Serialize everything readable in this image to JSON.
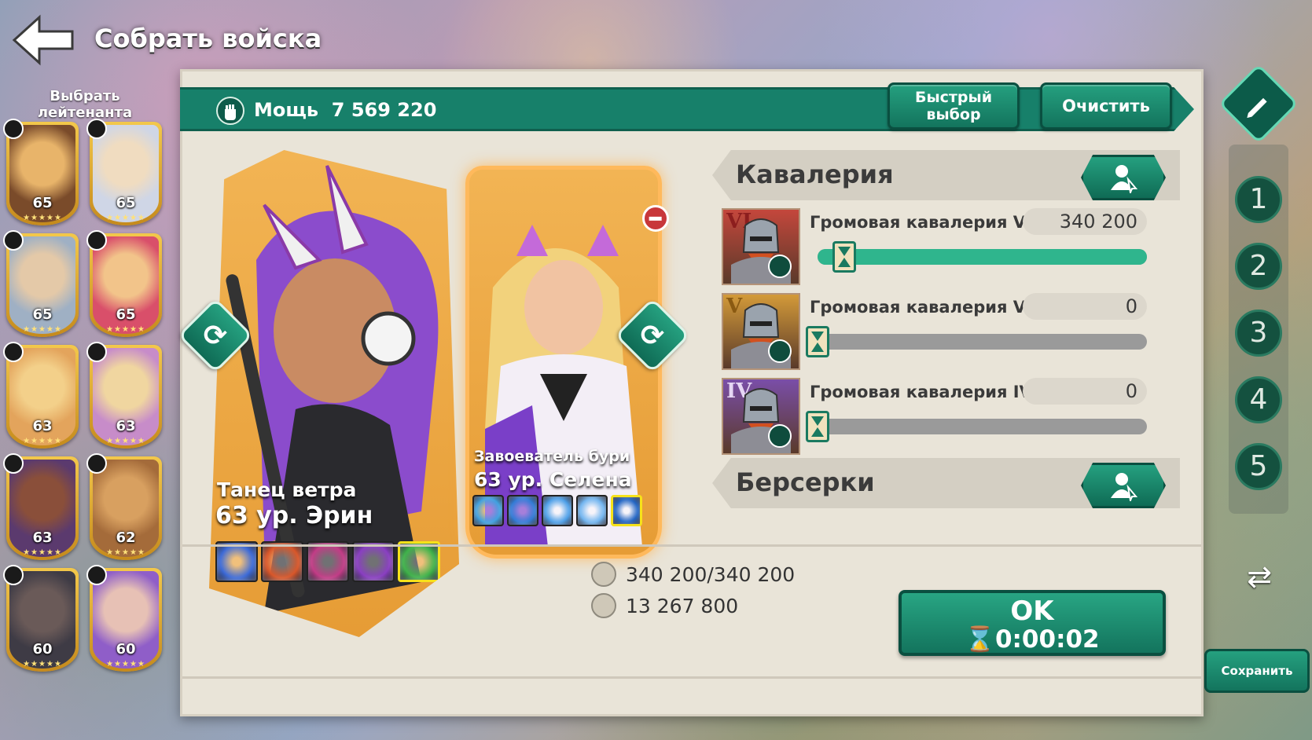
{
  "header": {
    "title": "Собрать войска"
  },
  "lieutenants": {
    "label": "Выбрать лейтенанта",
    "items": [
      {
        "level": "65",
        "colors": [
          "#e8b46a",
          "#7a4b2a"
        ]
      },
      {
        "level": "65",
        "colors": [
          "#f0dcc0",
          "#cfd6e6"
        ]
      },
      {
        "level": "65",
        "colors": [
          "#e4c9a8",
          "#9fb0c4"
        ]
      },
      {
        "level": "65",
        "colors": [
          "#f2c48a",
          "#d94f6a"
        ]
      },
      {
        "level": "63",
        "colors": [
          "#f3d08a",
          "#e3a45c"
        ]
      },
      {
        "level": "63",
        "colors": [
          "#f0d6a0",
          "#c78cc9"
        ]
      },
      {
        "level": "63",
        "colors": [
          "#8a4f3a",
          "#5b3a6e"
        ]
      },
      {
        "level": "62",
        "colors": [
          "#d8a060",
          "#a46b3a"
        ]
      },
      {
        "level": "60",
        "colors": [
          "#6a5a58",
          "#3e3b45"
        ]
      },
      {
        "level": "60",
        "colors": [
          "#e7c1b5",
          "#8f5ec8"
        ]
      }
    ]
  },
  "power": {
    "label": "Мощь",
    "value": "7 569 220"
  },
  "toolbar": {
    "quick_select": "Быстрый выбор",
    "clear": "Очистить"
  },
  "heroes": [
    {
      "title": "Танец ветра",
      "name": "63 ур. Эрин",
      "colors": [
        "#3d6bd8",
        "#d9572a",
        "#c23c86",
        "#8a3fc2",
        "#3fb34a"
      ]
    },
    {
      "title": "Завоеватель бури",
      "name": "63 ур. Селена",
      "colors": [
        "#3da0e0",
        "#2f7ad6",
        "#4a9ee8",
        "#6fb4f0",
        "#1e63c4"
      ]
    }
  ],
  "cavalry": {
    "section": "Кавалерия",
    "troops": [
      {
        "tier": "VI",
        "name": "Громовая кавалерия VI",
        "count": "340 200",
        "fill": 1.0,
        "bg": "#c4473c",
        "tier_color": "#8c1e1e"
      },
      {
        "tier": "V",
        "name": "Громовая кавалерия V",
        "count": "0",
        "fill": 0.0,
        "bg": "#d39a39",
        "tier_color": "#8a5a12"
      },
      {
        "tier": "IV",
        "name": "Громовая кавалерия IV",
        "count": "0",
        "fill": 0.0,
        "bg": "#7a4ea8",
        "tier_color": "#e6d6f4"
      }
    ]
  },
  "berserkers": {
    "section": "Берсерки"
  },
  "summary": {
    "troops": "340 200/340 200",
    "load": "13 267 800"
  },
  "ok": {
    "label": "OK",
    "time": "0:00:02"
  },
  "presets": [
    "1",
    "2",
    "3",
    "4",
    "5"
  ],
  "save": "Сохранить",
  "colors": {
    "accent": "#17806a",
    "panel": "#e9e4d8"
  }
}
